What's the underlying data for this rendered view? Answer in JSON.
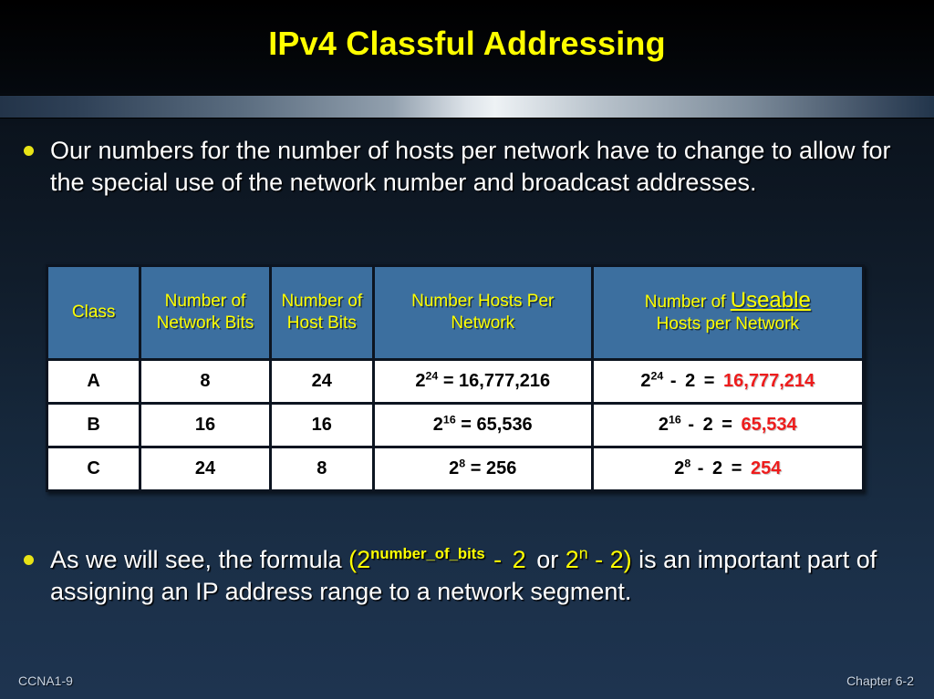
{
  "slide": {
    "title": "IPv4 Classful Addressing"
  },
  "bullets": {
    "first": "Our numbers for the number of hosts per network have to change to allow for the special use of the network number and broadcast addresses.",
    "second": {
      "lead": "As we will see, the formula ",
      "formula_open": "(2",
      "formula_exp": "number_of_bits",
      "formula_minus": "  -  2  ",
      "formula_or": "or",
      "formula_alt_base": " 2",
      "formula_alt_exp": "n",
      "formula_alt_tail": " - 2)",
      "tail": " is an important part of assigning an IP address range to a network segment."
    }
  },
  "table": {
    "headers": [
      {
        "label": "Class"
      },
      {
        "label": "Number of Network Bits"
      },
      {
        "label": "Number of Host Bits"
      },
      {
        "label": "Number Hosts Per Network"
      },
      {
        "label_part1": "Number of ",
        "label_useable": "Useable",
        "label_part2": "Hosts per Network"
      }
    ],
    "rows": [
      {
        "class": "A",
        "network_bits": "8",
        "host_bits": "24",
        "hosts_base": "2",
        "hosts_exp": "24",
        "hosts_eq": " = 16,777,216",
        "useable_base": "2",
        "useable_exp": "24",
        "useable_mid": "  -  2  =  ",
        "useable_value": "16,777,214"
      },
      {
        "class": "B",
        "network_bits": "16",
        "host_bits": "16",
        "hosts_base": "2",
        "hosts_exp": "16",
        "hosts_eq": " = 65,536",
        "useable_base": "2",
        "useable_exp": "16",
        "useable_mid": "  -  2  =  ",
        "useable_value": "65,534"
      },
      {
        "class": "C",
        "network_bits": "24",
        "host_bits": "8",
        "hosts_base": "2",
        "hosts_exp": "8",
        "hosts_eq": " = 256",
        "useable_base": "2",
        "useable_exp": "8",
        "useable_mid": "  -  2  =  ",
        "useable_value": "254"
      }
    ]
  },
  "footer": {
    "left": "CCNA1-9",
    "right": "Chapter 6-2"
  },
  "colors": {
    "title_yellow": "#ffff00",
    "header_blue": "#3c6f9f",
    "red_value": "#ee1c1c",
    "bullet_yellow": "#e8e316",
    "background_top": "#05080c",
    "background_bottom": "#1e3450"
  }
}
